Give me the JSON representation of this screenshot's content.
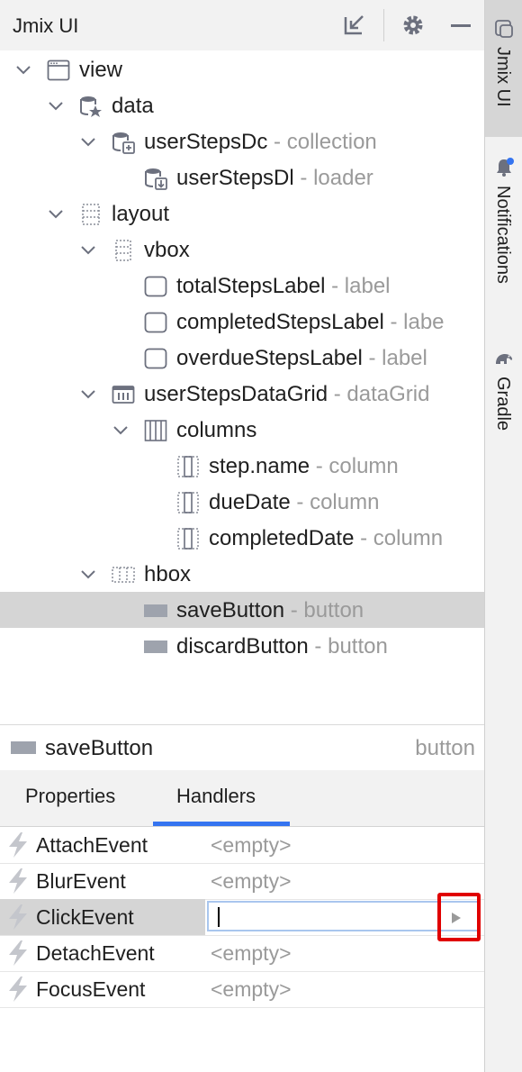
{
  "header": {
    "title": "Jmix UI",
    "icons": [
      "collapse-icon",
      "gear-icon",
      "minimize-icon"
    ]
  },
  "tree": {
    "nodes": [
      {
        "name": "view",
        "type": ""
      },
      {
        "name": "data",
        "type": ""
      },
      {
        "name": "userStepsDc",
        "type": " - collection"
      },
      {
        "name": "userStepsDl",
        "type": " - loader"
      },
      {
        "name": "layout",
        "type": ""
      },
      {
        "name": "vbox",
        "type": ""
      },
      {
        "name": "totalStepsLabel",
        "type": " - label"
      },
      {
        "name": "completedStepsLabel",
        "type": " - labe"
      },
      {
        "name": "overdueStepsLabel",
        "type": " - label"
      },
      {
        "name": "userStepsDataGrid",
        "type": " - dataGrid"
      },
      {
        "name": "columns",
        "type": ""
      },
      {
        "name": "step.name",
        "type": " - column"
      },
      {
        "name": "dueDate",
        "type": " - column"
      },
      {
        "name": "completedDate",
        "type": " - column"
      },
      {
        "name": "hbox",
        "type": ""
      },
      {
        "name": "saveButton",
        "type": " - button"
      },
      {
        "name": "discardButton",
        "type": " - button"
      }
    ]
  },
  "selection": {
    "name": "saveButton",
    "type": "button"
  },
  "tabs": {
    "properties": "Properties",
    "handlers": "Handlers",
    "active": "Handlers"
  },
  "handlers": [
    {
      "name": "AttachEvent",
      "value": "<empty>"
    },
    {
      "name": "BlurEvent",
      "value": "<empty>"
    },
    {
      "name": "ClickEvent",
      "value": ""
    },
    {
      "name": "DetachEvent",
      "value": "<empty>"
    },
    {
      "name": "FocusEvent",
      "value": "<empty>"
    }
  ],
  "sidebar": {
    "tabs": [
      {
        "label": "Jmix UI",
        "icon": "jmix-icon",
        "active": true
      },
      {
        "label": "Notifications",
        "icon": "bell-icon",
        "active": false
      },
      {
        "label": "Gradle",
        "icon": "elephant-icon",
        "active": false
      }
    ]
  },
  "colors": {
    "accent": "#3574f0",
    "highlight": "#e00000",
    "selection": "#d5d5d5",
    "muted_text": "#9a9a9a"
  }
}
